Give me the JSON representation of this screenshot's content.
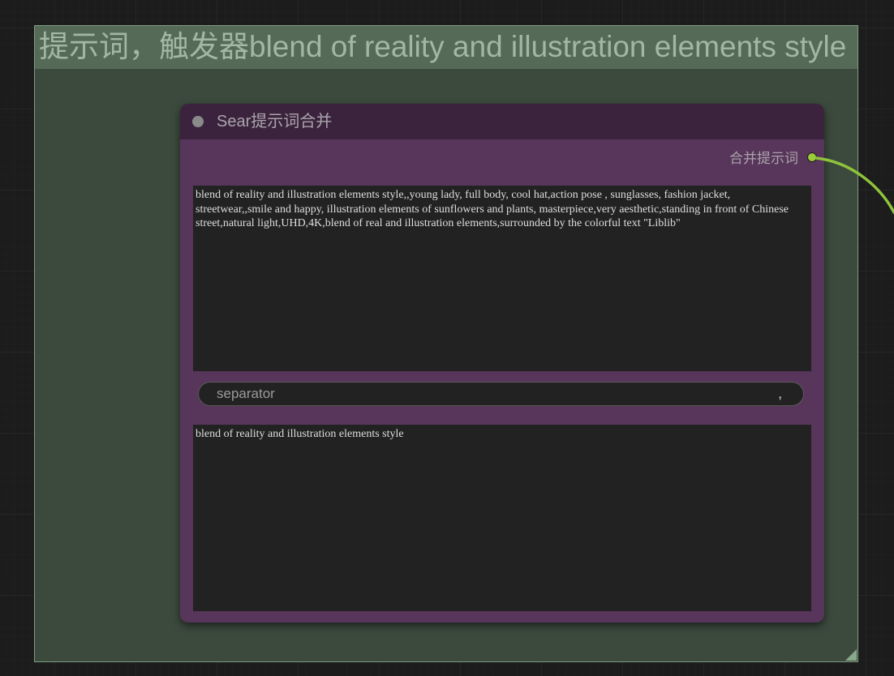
{
  "group": {
    "title": "提示词，触发器blend of reality and illustration elements style",
    "color": "#556b57"
  },
  "node": {
    "title": "Sear提示词合并",
    "color": "#58355a",
    "header_color": "#3b233e",
    "output": {
      "label": "合并提示词",
      "port_color": "#9ccc3b"
    },
    "text_input_1": {
      "value": "blend of reality and illustration elements style,,young lady, full body, cool hat,action pose , sunglasses, fashion jacket, streetwear,,smile and happy, illustration elements of sunflowers and plants, masterpiece,very aesthetic,standing in front of Chinese street,natural light,UHD,4K,blend of real and illustration elements,surrounded by the colorful text \"Liblib\""
    },
    "separator": {
      "label": "separator",
      "value": ","
    },
    "text_input_2": {
      "value": "blend of reality and illustration elements style"
    }
  },
  "icons": {
    "collapse": "node-collapse-dot-icon",
    "output": "output-port-icon",
    "resize": "resize-handle-icon"
  }
}
